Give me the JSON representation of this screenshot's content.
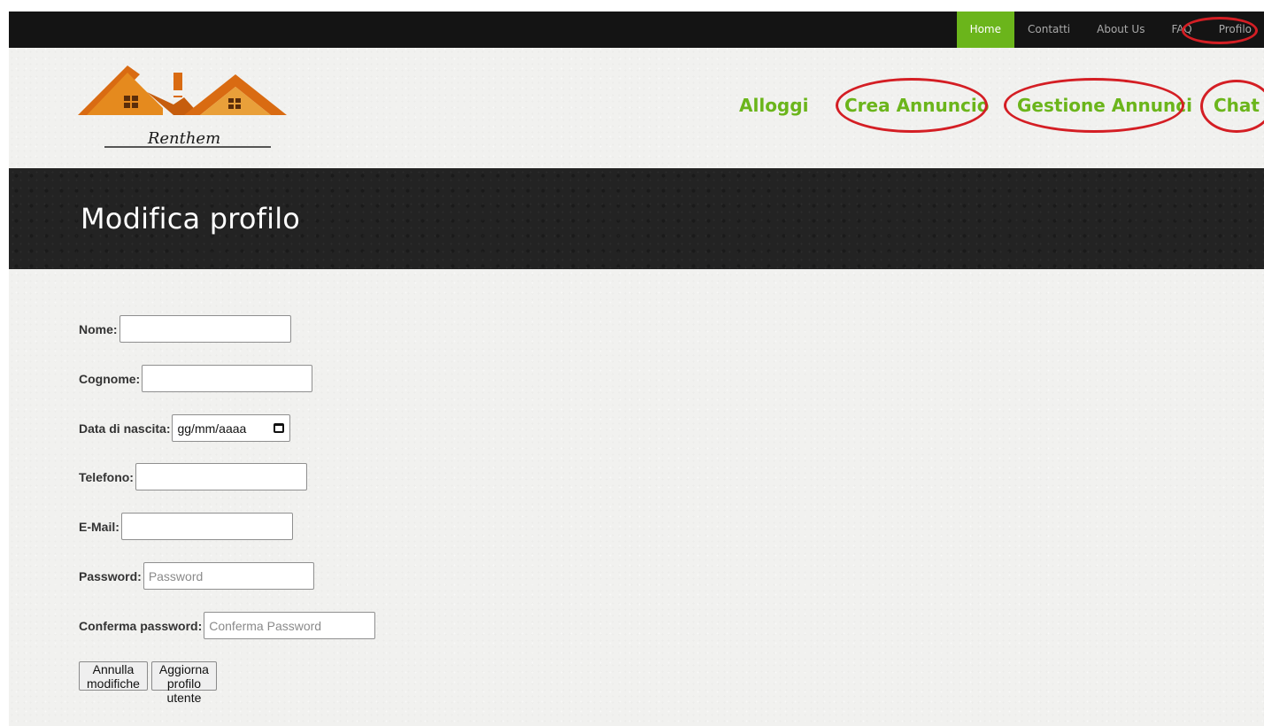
{
  "top_nav": {
    "items": [
      {
        "label": "Home",
        "active": true
      },
      {
        "label": "Contatti",
        "active": false
      },
      {
        "label": "About Us",
        "active": false
      },
      {
        "label": "FAQ",
        "active": false
      },
      {
        "label": "Profilo",
        "active": false
      }
    ]
  },
  "logo": {
    "text": "Renthem"
  },
  "main_nav": {
    "items": [
      "Alloggi",
      "Crea Annuncio",
      "Gestione Annunci",
      "Chat"
    ]
  },
  "banner": {
    "title": "Modifica profilo"
  },
  "form": {
    "nome": {
      "label": "Nome:",
      "value": "",
      "placeholder": ""
    },
    "cognome": {
      "label": "Cognome:",
      "value": "",
      "placeholder": ""
    },
    "data_nascita": {
      "label": "Data di nascita:",
      "placeholder": "gg/mm/aaaa"
    },
    "telefono": {
      "label": "Telefono:",
      "value": "",
      "placeholder": ""
    },
    "email": {
      "label": "E-Mail:",
      "value": "",
      "placeholder": ""
    },
    "password": {
      "label": "Password:",
      "value": "",
      "placeholder": "Password"
    },
    "conferma_password": {
      "label": "Conferma password:",
      "value": "",
      "placeholder": "Conferma Password"
    },
    "buttons": {
      "cancel": "Annulla modifiche",
      "submit": "Aggiorna profilo utente"
    }
  },
  "colors": {
    "accent_green": "#6bb51b",
    "annotation_red": "#d41e24",
    "topbar_bg": "#141414",
    "banner_bg": "#232323",
    "page_bg": "#f1f1ef",
    "logo_orange": "#d96b12"
  }
}
